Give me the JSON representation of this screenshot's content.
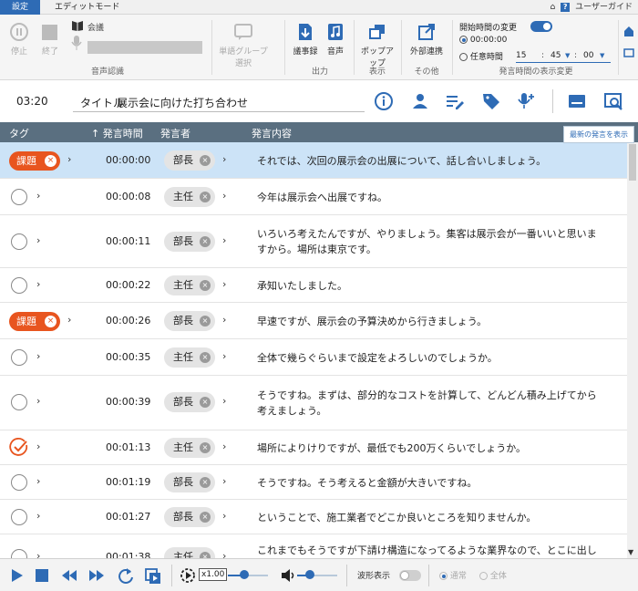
{
  "tabs": [
    "設定",
    "エディットモード"
  ],
  "topright": {
    "home_glyph": "⌂",
    "help_glyph": "?",
    "guide_label": "ユーザーガイド"
  },
  "ribbon": {
    "stop_label": "停止",
    "end_label": "終了",
    "mic_meeting_label": "会議",
    "voice_group_label": "音声認識",
    "word_group_label": "単語グループ選択",
    "minutes_label": "議事録",
    "audio_label": "音声",
    "output_group": "出力",
    "popup_label": "ポップアップ",
    "display_group": "表示",
    "external_label": "外部連携",
    "other_group": "その他",
    "start_change_label": "開始時間の変更",
    "radio1_label": "00:00:00",
    "radio2_label": "任意時間",
    "hh": "15",
    "mm": "45",
    "ss": "00",
    "time_sep": ":",
    "time_display_group": "発言時間の表示変更"
  },
  "title_row": {
    "time": "03:20",
    "label": "タイトル",
    "value": "展示会に向けた打ち合わせ"
  },
  "table_header": {
    "tag": "タグ",
    "time": "↑ 発言時間",
    "speaker": "発言者",
    "content": "発言内容"
  },
  "latest_button": "最新の発言を表示",
  "remove_glyph": "×",
  "rows": [
    {
      "tag": "課題",
      "time": "00:00:00",
      "speaker": "部長",
      "text": "それでは、次回の展示会の出展について、話し合いしましょう。"
    },
    {
      "tag": "",
      "time": "00:00:08",
      "speaker": "主任",
      "text": "今年は展示会へ出展ですね。"
    },
    {
      "tag": "",
      "time": "00:00:11",
      "speaker": "部長",
      "text": "いろいろ考えたんですが、やりましょう。集客は展示会が一番いいと思いますから。場所は東京です。"
    },
    {
      "tag": "",
      "time": "00:00:22",
      "speaker": "主任",
      "text": "承知いたしました。"
    },
    {
      "tag": "課題",
      "time": "00:00:26",
      "speaker": "部長",
      "text": "早速ですが、展示会の予算決めから行きましょう。"
    },
    {
      "tag": "",
      "time": "00:00:35",
      "speaker": "主任",
      "text": "全体で幾らぐらいまで設定をよろしいのでしょうか。"
    },
    {
      "tag": "",
      "time": "00:00:39",
      "speaker": "部長",
      "text": "そうですね。まずは、部分的なコストを計算して、どんどん積み上げてから考えましょう。"
    },
    {
      "tag": "check",
      "time": "00:01:13",
      "speaker": "主任",
      "text": "場所によりけりですが、最低でも200万くらいでしょうか。"
    },
    {
      "tag": "",
      "time": "00:01:19",
      "speaker": "部長",
      "text": "そうですね。そう考えると金額が大きいですね。"
    },
    {
      "tag": "",
      "time": "00:01:27",
      "speaker": "部長",
      "text": "ということで、施工業者でどこか良いところを知りませんか。"
    },
    {
      "tag": "",
      "time": "00:01:38",
      "speaker": "主任",
      "text": "これまでもそうですが下請け構造になってるような業界なので、とこに出しても同"
    }
  ],
  "bottom": {
    "speed": "x1.00",
    "wave_label": "波形表示",
    "normal_label": "通常",
    "all_label": "全体"
  },
  "colors": {
    "accent": "#2e6bb5",
    "tag": "#e8551f",
    "header": "#5a6f80"
  }
}
